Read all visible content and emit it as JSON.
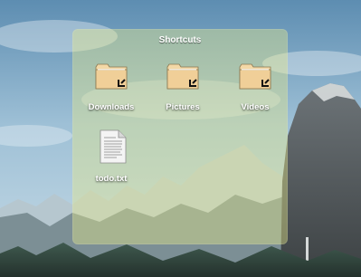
{
  "window": {
    "title": "Shortcuts"
  },
  "items": [
    {
      "label": "Downloads",
      "icon": "folder-link-icon"
    },
    {
      "label": "Pictures",
      "icon": "folder-link-icon"
    },
    {
      "label": "Videos",
      "icon": "folder-link-icon"
    },
    {
      "label": "todo.txt",
      "icon": "text-file-icon"
    }
  ],
  "colors": {
    "panel_tint": "#e8ec8a",
    "label_text": "#ffffff",
    "folder": "#f3d8a6"
  }
}
